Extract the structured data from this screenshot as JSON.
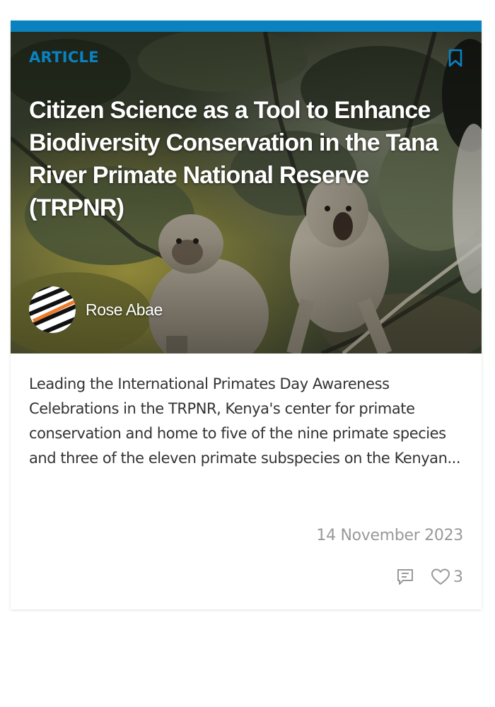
{
  "card": {
    "category": "ARTICLE",
    "title": "Citizen Science as a Tool to Enhance Biodiversity Conservation in the Tana River Primate National Reserve (TRPNR)",
    "author": "Rose Abae",
    "excerpt": "Leading the International Primates Day Awareness Celebrations in the TRPNR, Kenya's center for primate conservation and home to five of the nine primate species and three of the eleven primate subspecies on the Kenyan...",
    "date": "14 November 2023",
    "likes": "3",
    "icons": {
      "bookmark": "bookmark-icon",
      "comment": "comment-icon",
      "like": "heart-icon"
    },
    "colors": {
      "accent": "#0a82c0",
      "muted": "#999999",
      "text": "#333333"
    }
  }
}
